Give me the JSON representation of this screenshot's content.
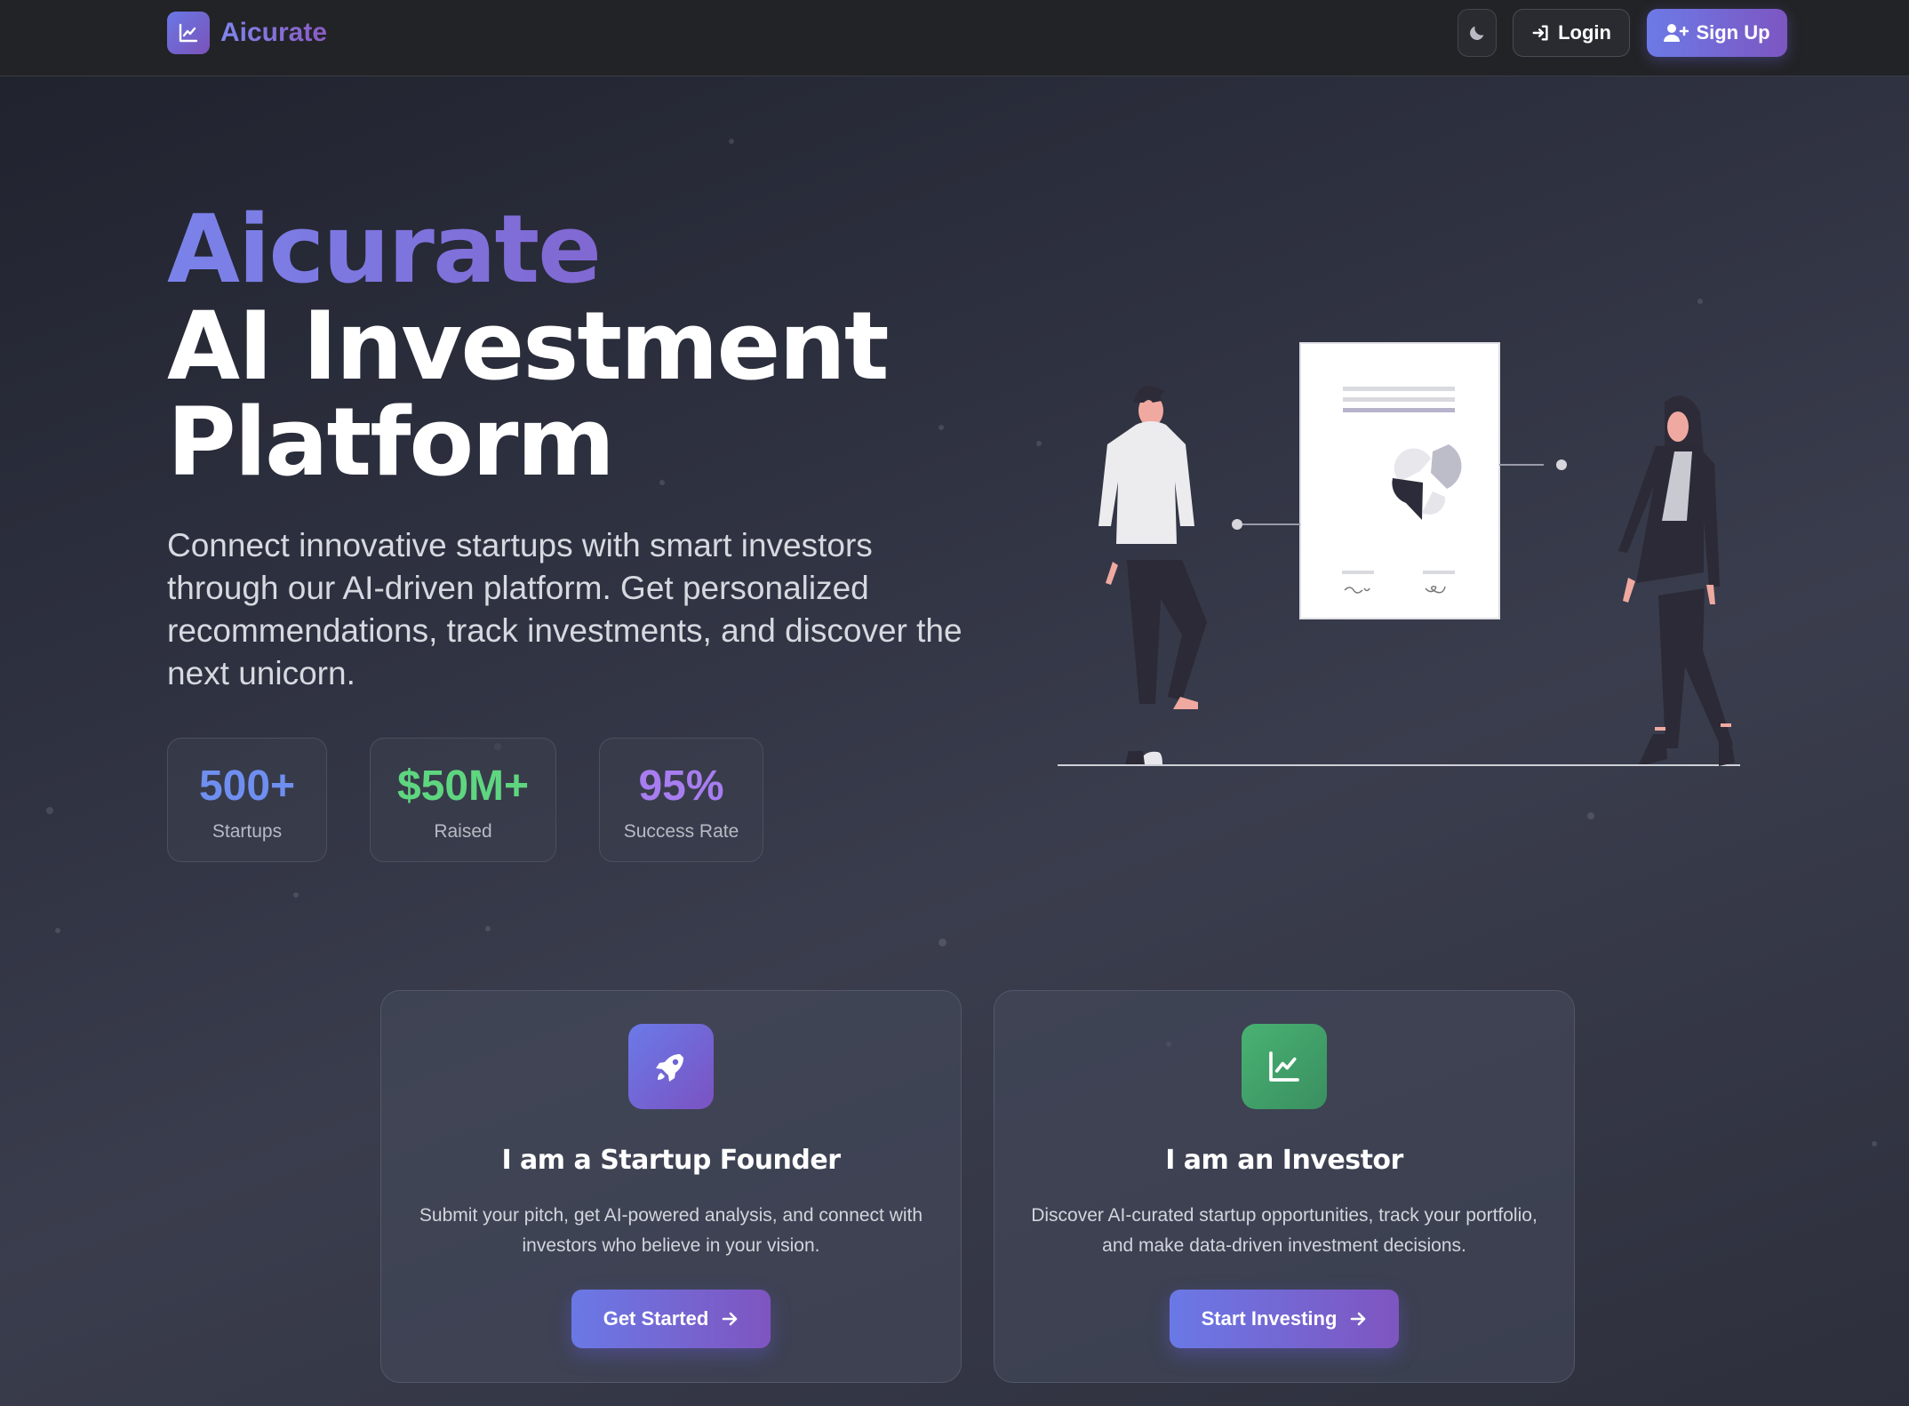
{
  "nav": {
    "brand": "Aicurate",
    "login_label": "Login",
    "signup_label": "Sign Up"
  },
  "hero": {
    "brand_line": "Aicurate",
    "title_line1": "AI Investment",
    "title_line2": "Platform",
    "description": "Connect innovative startups with smart investors through our AI-driven platform. Get personalized recommendations, track investments, and discover the next unicorn."
  },
  "stats": [
    {
      "value": "500+",
      "label": "Startups",
      "color": "#6f8ff0"
    },
    {
      "value": "$50M+",
      "label": "Raised",
      "color": "#5ed680"
    },
    {
      "value": "95%",
      "label": "Success Rate",
      "color": "#a77df0"
    }
  ],
  "cards": [
    {
      "icon": "rocket-icon",
      "title": "I am a Startup Founder",
      "description": "Submit your pitch, get AI-powered analysis, and connect with investors who believe in your vision.",
      "button": "Get Started"
    },
    {
      "icon": "chart-line-icon",
      "title": "I am an Investor",
      "description": "Discover AI-curated startup opportunities, track your portfolio, and make data-driven investment decisions.",
      "button": "Start Investing"
    }
  ],
  "colors": {
    "accent_start": "#6a79e6",
    "accent_end": "#7f55c0",
    "founder_icon_bg": "#6c6ad8",
    "investor_icon_bg": "#3fa46a"
  }
}
